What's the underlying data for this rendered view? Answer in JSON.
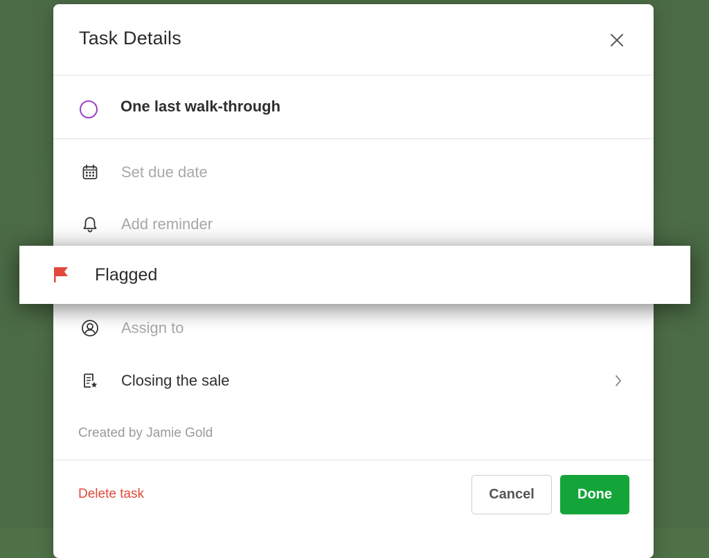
{
  "modal": {
    "title": "Task Details"
  },
  "task": {
    "name": "One last walk-through",
    "check_color": "#9b3fc4"
  },
  "fields": {
    "due_date": "Set due date",
    "reminder": "Add reminder",
    "flagged": "Flagged",
    "assign": "Assign to",
    "project": "Closing the sale"
  },
  "meta": {
    "created_by": "Created by Jamie Gold"
  },
  "footer": {
    "delete_label": "Delete task",
    "cancel_label": "Cancel",
    "done_label": "Done"
  },
  "colors": {
    "accent_green": "#14a53a",
    "delete_red": "#e04a3a",
    "flag_red": "#e2483b"
  },
  "icons": {
    "close": "close-icon",
    "due_date": "calendar-icon",
    "reminder": "bell-icon",
    "flagged": "flag-icon",
    "assign": "user-circle-icon",
    "project": "project-list-icon",
    "project_nav": "chevron-right-icon"
  }
}
